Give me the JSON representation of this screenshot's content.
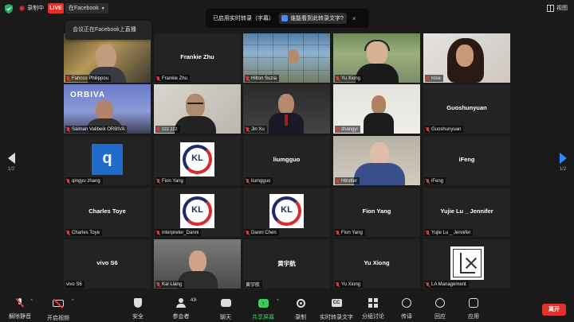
{
  "topbar": {
    "recording_label": "录制中",
    "live_badge": "LIVE",
    "live_target": "在Facebook",
    "view_label": "视图"
  },
  "live_tooltip": "会议正在Facebook上直播",
  "transcript_banner": {
    "label": "已启用实时转录（字幕）",
    "link": "谁能看到此转录文字?",
    "close_glyph": "×"
  },
  "tiles": [
    {
      "name": "Fahcco Philippou",
      "center": "",
      "video": "v1"
    },
    {
      "name": "Frankie Zhu",
      "center": "Frankie Zhu",
      "video": ""
    },
    {
      "name": "Hilton Suzia",
      "center": "",
      "video": "v2"
    },
    {
      "name": "Yu Xiong",
      "center": "",
      "video": "v3",
      "active": true
    },
    {
      "name": "rose",
      "center": "",
      "video": "v4"
    },
    {
      "name": "Salman Valibeik ORBIVA",
      "center": "",
      "video": "v5",
      "overlay": "ORBIVA"
    },
    {
      "name": "zzz zzz",
      "center": "",
      "video": "v6"
    },
    {
      "name": "Jin Xu",
      "center": "",
      "video": "v7"
    },
    {
      "name": "zhangyi",
      "center": "",
      "video": "v8"
    },
    {
      "name": "Guoshunyuan",
      "center": "Guoshunyuan",
      "video": ""
    },
    {
      "name": "qingyu zhang",
      "center": "",
      "video": "q"
    },
    {
      "name": "Fion Yang",
      "center": "",
      "video": "kl"
    },
    {
      "name": "liumgguo",
      "center": "liumgguo",
      "video": ""
    },
    {
      "name": "Htrotter",
      "center": "",
      "video": "v9"
    },
    {
      "name": "iFeng",
      "center": "iFeng",
      "video": ""
    },
    {
      "name": "Charles Toye",
      "center": "Charles Toye",
      "video": ""
    },
    {
      "name": "interpreter_Danni",
      "center": "",
      "video": "kl"
    },
    {
      "name": "Danni Chen",
      "center": "",
      "video": "kl"
    },
    {
      "name": "Fion Yang",
      "center": "Fion Yang",
      "video": ""
    },
    {
      "name": "Yujie Lu _ Jennifer",
      "center": "Yujie Lu _ Jennifer",
      "video": ""
    },
    {
      "name": "vivo S6",
      "center": "vivo S6",
      "video": "",
      "muted": false
    },
    {
      "name": "Kai Liang",
      "center": "",
      "video": "v10"
    },
    {
      "name": "黄宇航",
      "center": "黄宇航",
      "video": "",
      "muted": false
    },
    {
      "name": "Yu Xiong",
      "center": "Yu Xiong",
      "video": ""
    },
    {
      "name": "LA Management",
      "center": "",
      "video": "la"
    }
  ],
  "logos": {
    "q": "q",
    "kl": "KL"
  },
  "pager": {
    "left": "1/2",
    "right": "1/2"
  },
  "toolbar": {
    "unmute": "解除静音",
    "start_video": "开启视频",
    "security": "安全",
    "participants": "参会者",
    "participant_count": "43",
    "chat": "聊天",
    "share": "共享屏幕",
    "share_glyph": "↑",
    "record": "录制",
    "transcript": "实时转录文字",
    "cc_glyph": "CC",
    "breakout": "分组讨论",
    "interpret": "传译",
    "reactions": "回应",
    "apps": "应用",
    "leave": "离开"
  },
  "colors": {
    "accent": "#2d8cff",
    "live": "#e0322b",
    "share": "#3ecb5a",
    "active_border": "#c9e27a"
  }
}
